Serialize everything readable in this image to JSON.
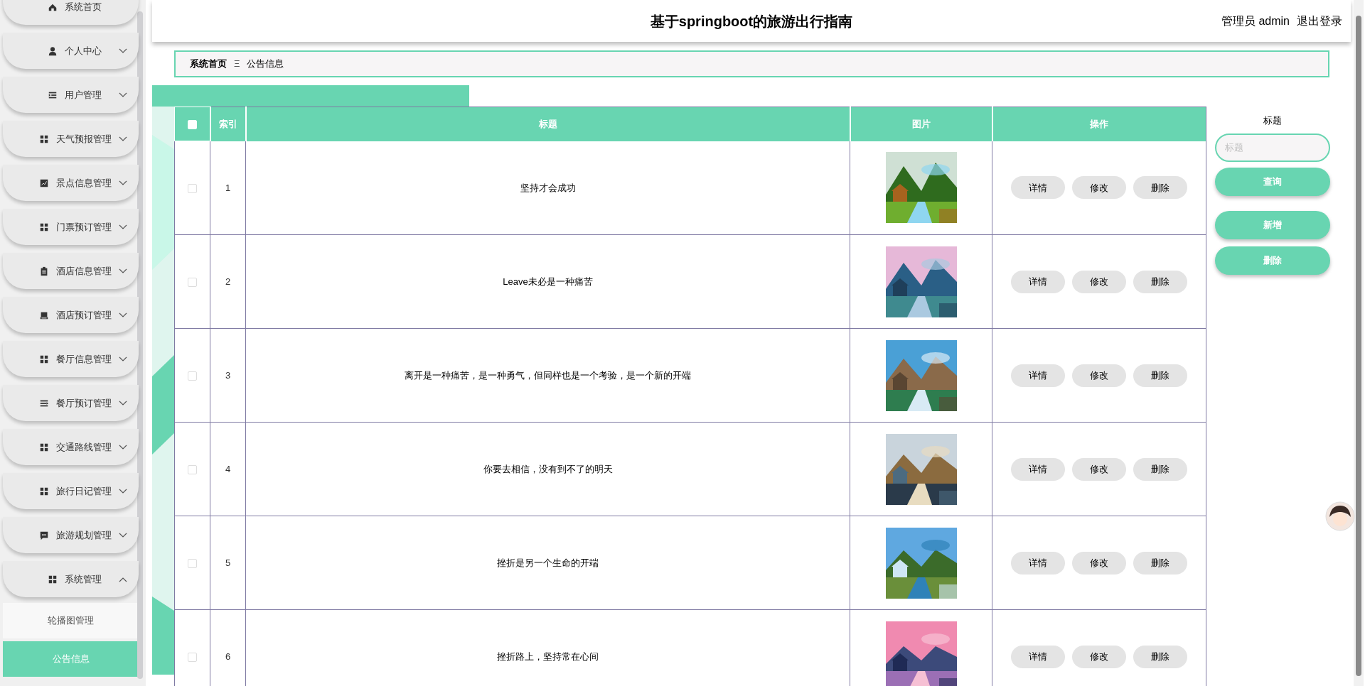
{
  "sidebar": {
    "items": [
      {
        "label": "系统首页"
      },
      {
        "label": "个人中心",
        "expanded": false
      },
      {
        "label": "用户管理",
        "expanded": false
      },
      {
        "label": "天气预报管理",
        "expanded": false
      },
      {
        "label": "景点信息管理",
        "expanded": false
      },
      {
        "label": "门票预订管理",
        "expanded": false
      },
      {
        "label": "酒店信息管理",
        "expanded": false
      },
      {
        "label": "酒店预订管理",
        "expanded": false
      },
      {
        "label": "餐厅信息管理",
        "expanded": false
      },
      {
        "label": "餐厅预订管理",
        "expanded": false
      },
      {
        "label": "交通路线管理",
        "expanded": false
      },
      {
        "label": "旅行日记管理",
        "expanded": false
      },
      {
        "label": "旅游规划管理",
        "expanded": false
      },
      {
        "label": "系统管理",
        "expanded": true,
        "children": [
          {
            "label": "轮播图管理",
            "selected": false
          },
          {
            "label": "公告信息",
            "selected": true
          }
        ]
      }
    ]
  },
  "header": {
    "title": "基于springboot的旅游出行指南",
    "user": "管理员 admin",
    "logout": "退出登录"
  },
  "breadcrumb": {
    "home": "系统首页",
    "separator": "Ξ",
    "current": "公告信息"
  },
  "table": {
    "select_all_checked": false,
    "columns": [
      "索引",
      "标题",
      "图片",
      "操作"
    ],
    "rows": [
      {
        "checked": false,
        "index": "1",
        "title": "坚持才会成功",
        "actions": [
          "详情",
          "修改",
          "删除"
        ]
      },
      {
        "checked": false,
        "index": "2",
        "title": "Leave未必是一种痛苦",
        "actions": [
          "详情",
          "修改",
          "删除"
        ]
      },
      {
        "checked": false,
        "index": "3",
        "title": "离开是一种痛苦，是一种勇气，但同样也是一个考验，是一个新的开端",
        "actions": [
          "详情",
          "修改",
          "删除"
        ]
      },
      {
        "checked": false,
        "index": "4",
        "title": "你要去相信，没有到不了的明天",
        "actions": [
          "详情",
          "修改",
          "删除"
        ]
      },
      {
        "checked": false,
        "index": "5",
        "title": "挫折是另一个生命的开端",
        "actions": [
          "详情",
          "修改",
          "删除"
        ]
      },
      {
        "checked": false,
        "index": "6",
        "title": "挫折路上，坚持常在心间",
        "actions": [
          "详情",
          "修改",
          "删除"
        ]
      }
    ]
  },
  "search": {
    "label": "标题",
    "placeholder": "标题",
    "buttons": [
      "查询",
      "新增",
      "删除"
    ]
  }
}
